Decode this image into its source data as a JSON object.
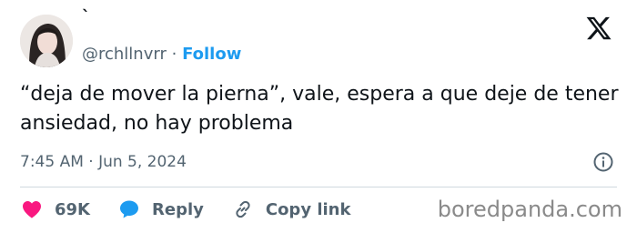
{
  "author": {
    "display_name": "`",
    "handle": "@rchllnvrr",
    "separator": "·",
    "follow_label": "Follow"
  },
  "tweet": {
    "text": "“deja de mover la pierna”, vale, espera a que deje de tener ansiedad, no hay problema",
    "timestamp": "7:45 AM · Jun 5, 2024"
  },
  "actions": {
    "likes_count": "69K",
    "reply_label": "Reply",
    "copy_link_label": "Copy link"
  },
  "watermark": "boredpanda.com",
  "colors": {
    "accent": "#1d9bf0",
    "like": "#f91880",
    "text": "#0f1419",
    "muted": "#536471"
  }
}
